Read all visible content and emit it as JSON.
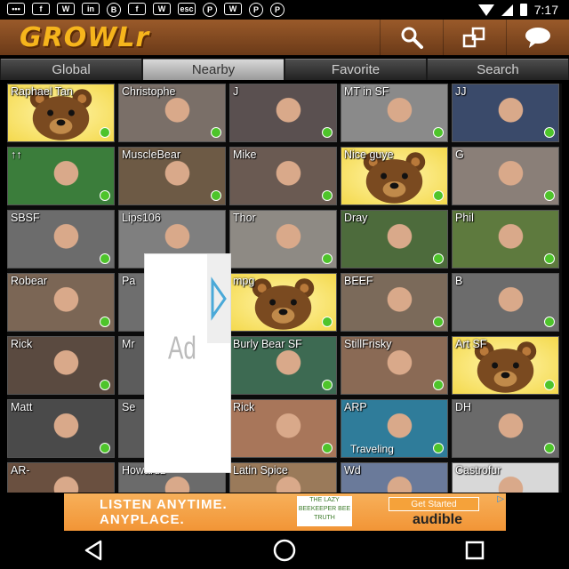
{
  "status_bar": {
    "icons": [
      "chat-bubble-icon",
      "facebook-icon",
      "wolf-icon",
      "linkedin-icon",
      "b-circle-icon",
      "facebook-icon",
      "wolf-icon",
      "esc-icon",
      "pinterest-icon",
      "wolf-icon",
      "pinterest-icon",
      "pinterest-icon"
    ],
    "time": "7:17"
  },
  "app": {
    "logo": "GROWLr"
  },
  "tabs": [
    "Global",
    "Nearby",
    "Favorite",
    "Search"
  ],
  "active_tab": "Nearby",
  "profiles": [
    {
      "name": "Raphael Tan",
      "bear": true,
      "color": "#e8c850"
    },
    {
      "name": "Christophe",
      "bear": false,
      "color": "#7a6f68"
    },
    {
      "name": "J",
      "bear": false,
      "color": "#5a5050"
    },
    {
      "name": "MT in SF",
      "bear": false,
      "color": "#8a8a8a"
    },
    {
      "name": "JJ",
      "bear": false,
      "color": "#3a4a6a"
    },
    {
      "name": "↑↑",
      "bear": false,
      "color": "#3b7d3b"
    },
    {
      "name": "MuscleBear",
      "bear": false,
      "color": "#6d5a45"
    },
    {
      "name": "Mike",
      "bear": false,
      "color": "#6a5a52"
    },
    {
      "name": "Nice guye",
      "bear": true,
      "color": "#e8c850"
    },
    {
      "name": "G",
      "bear": false,
      "color": "#8a7f78"
    },
    {
      "name": "SBSF",
      "bear": false,
      "color": "#6c6c6c"
    },
    {
      "name": "Lips106",
      "bear": false,
      "color": "#7f7f7f"
    },
    {
      "name": "Thor",
      "bear": false,
      "color": "#8e8a84"
    },
    {
      "name": "Dray",
      "bear": false,
      "color": "#4d6b3c"
    },
    {
      "name": "Phil",
      "bear": false,
      "color": "#5e7a3e"
    },
    {
      "name": "Robear",
      "bear": false,
      "color": "#7b6655"
    },
    {
      "name": "Pa",
      "bear": false,
      "color": "#6e6e6e"
    },
    {
      "name": "mpg",
      "bear": true,
      "color": "#e8c850"
    },
    {
      "name": "BEEF",
      "bear": false,
      "color": "#7b6a5a"
    },
    {
      "name": "B",
      "bear": false,
      "color": "#6c6c6c"
    },
    {
      "name": "Rick",
      "bear": false,
      "color": "#5a4a40"
    },
    {
      "name": "Mr",
      "bear": false,
      "color": "#5c5c5c"
    },
    {
      "name": "Burly Bear SF",
      "bear": false,
      "color": "#3d6a52"
    },
    {
      "name": "StillFrisky",
      "bear": false,
      "color": "#8a6a55"
    },
    {
      "name": "Art SF",
      "bear": true,
      "color": "#e8c850"
    },
    {
      "name": "Matt",
      "bear": false,
      "color": "#4a4a4a"
    },
    {
      "name": "Se",
      "bear": false,
      "color": "#5a5a5a"
    },
    {
      "name": "Rick",
      "bear": false,
      "color": "#a8765a"
    },
    {
      "name": "ARP",
      "bear": false,
      "color": "#2f7c9a",
      "sub": "Traveling"
    },
    {
      "name": "DH",
      "bear": false,
      "color": "#6a6a6a"
    },
    {
      "name": "AR-",
      "bear": false,
      "color": "#6a5040"
    },
    {
      "name": "Howardz",
      "bear": false,
      "color": "#6b6b6b"
    },
    {
      "name": "Latin Spice",
      "bear": false,
      "color": "#9a7a5a"
    },
    {
      "name": "Wd",
      "bear": false,
      "color": "#6a7a9a"
    },
    {
      "name": "Castrofur",
      "bear": false,
      "color": "#d8d8d8"
    }
  ],
  "ad_overlay": {
    "label": "Ad"
  },
  "banner": {
    "line1": "LISTEN ANYTIME.",
    "line2": "ANYPLACE.",
    "cta": "Get Started",
    "brand": "audible",
    "partner": "THE LAZY BEEKEEPER BEE TRUTH",
    "info": "▷"
  }
}
